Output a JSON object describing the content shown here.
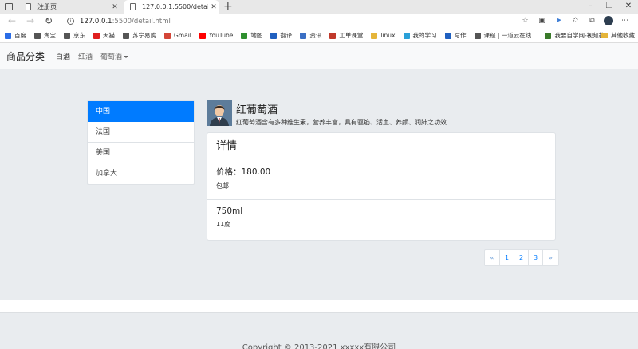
{
  "browser": {
    "tabs": [
      {
        "label": "注册页",
        "active": false
      },
      {
        "label": "127.0.0.1:5500/detail.html",
        "active": true
      }
    ],
    "new_tab": "+",
    "url_host": "127.0.0.1",
    "url_path": ":5500/detail.html",
    "bookmarks": [
      {
        "label": "百度",
        "color": "#2b6de6"
      },
      {
        "label": "淘宝",
        "color": "#555555"
      },
      {
        "label": "京东",
        "color": "#555555"
      },
      {
        "label": "天猫",
        "color": "#e01f1f"
      },
      {
        "label": "苏宁易购",
        "color": "#555555"
      },
      {
        "label": "Gmail",
        "color": "#d44638"
      },
      {
        "label": "YouTube",
        "color": "#ff0000"
      },
      {
        "label": "地图",
        "color": "#2f8f2f"
      },
      {
        "label": "翻译",
        "color": "#2060c0"
      },
      {
        "label": "资讯",
        "color": "#3a6fc4"
      },
      {
        "label": "工单课堂",
        "color": "#c0392b"
      },
      {
        "label": "linux",
        "color": "#e5b53a"
      },
      {
        "label": "我的学习",
        "color": "#2aa0d8"
      },
      {
        "label": "写作",
        "color": "#2060c0"
      },
      {
        "label": "课程 | 一道云在线...",
        "color": "#555555"
      },
      {
        "label": "我要自学网-视频教...",
        "color": "#3a7a2a"
      }
    ],
    "other_bookmarks": "其他收藏"
  },
  "navbar": {
    "brand": "商品分类",
    "links": [
      "白酒",
      "红酒",
      "葡萄酒"
    ]
  },
  "sidebar": {
    "items": [
      "中国",
      "法国",
      "美国",
      "加拿大"
    ],
    "active_index": 0
  },
  "product": {
    "title": "红葡萄酒",
    "description": "红葡萄酒含有多种维生素，营养丰富，具有驱筋、活血、养颜、润肺之功效"
  },
  "card": {
    "header": "详情",
    "items": [
      {
        "title": "价格：180.00",
        "text": "包邮"
      },
      {
        "title": "750ml",
        "text": "11度"
      }
    ]
  },
  "pagination": {
    "prev": "«",
    "pages": [
      "1",
      "2",
      "3"
    ],
    "next": "»"
  },
  "footer": {
    "copyright": "Copyright © 2013-2021 xxxxx有限公司"
  },
  "colors": {
    "primary": "#007bff",
    "page_bg": "#e9ecef",
    "navbar_bg": "#f8f9fa"
  }
}
